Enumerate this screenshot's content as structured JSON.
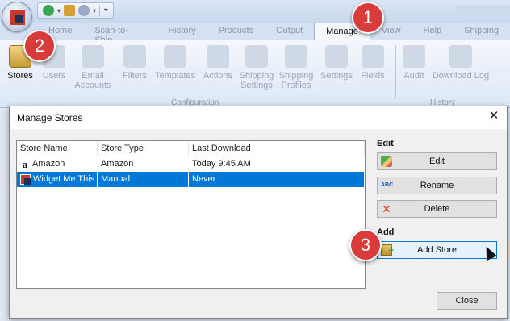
{
  "qat": {
    "icons": [
      "back-icon",
      "box-icon",
      "settings-icon"
    ],
    "dropdown": "chevron-down-icon"
  },
  "tabs": [
    "Home",
    "Scan-to-Ship",
    "History",
    "Products",
    "Output",
    "Manage",
    "View",
    "Help",
    "Shipping"
  ],
  "active_tab": "Manage",
  "ribbon": {
    "buttons": [
      {
        "label": "Stores",
        "enabled": true
      },
      {
        "label": "Users",
        "enabled": false
      },
      {
        "label": "Email Accounts",
        "enabled": false
      },
      {
        "label": "Filters",
        "enabled": false
      },
      {
        "label": "Templates",
        "enabled": false
      },
      {
        "label": "Actions",
        "enabled": false
      },
      {
        "label": "Shipping Settings",
        "enabled": false
      },
      {
        "label": "Shipping Profiles",
        "enabled": false
      },
      {
        "label": "Settings",
        "enabled": false
      },
      {
        "label": "Fields",
        "enabled": false
      },
      {
        "label": "Audit",
        "enabled": false
      },
      {
        "label": "Download Log",
        "enabled": false
      }
    ],
    "groups": [
      "Configuration",
      "History"
    ]
  },
  "dialog": {
    "title": "Manage Stores",
    "close_glyph": "✕",
    "columns": [
      "Store Name",
      "Store Type",
      "Last Download"
    ],
    "rows": [
      {
        "name": "Amazon",
        "type": "Amazon",
        "last": "Today 9:45 AM",
        "icon": "amazon-icon",
        "selected": false
      },
      {
        "name": "Widget Me This",
        "type": "Manual",
        "last": "Never",
        "icon": "store-icon",
        "selected": true
      }
    ],
    "edit_heading": "Edit",
    "edit_label": "Edit",
    "rename_label": "Rename",
    "delete_label": "Delete",
    "add_heading": "Add",
    "add_store_label": "Add Store",
    "close_label": "Close"
  },
  "markers": [
    "1",
    "2",
    "3"
  ],
  "colors": {
    "selection": "#0078d7",
    "marker": "#d93a3a"
  }
}
